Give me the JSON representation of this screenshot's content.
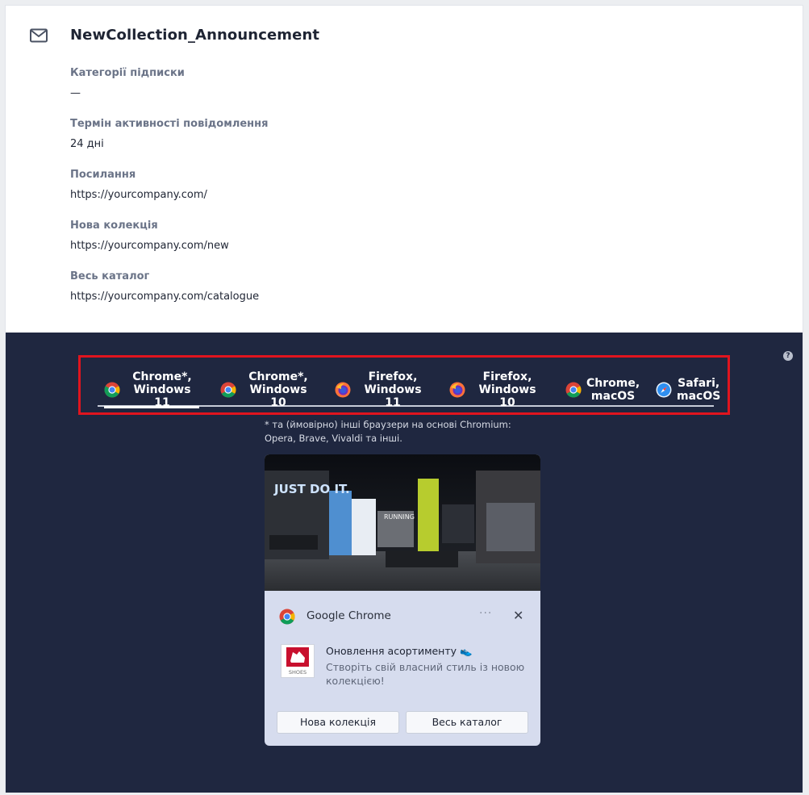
{
  "message": {
    "title": "NewCollection_Announcement",
    "icon": "envelope-icon"
  },
  "fields": [
    {
      "label": "Категорії підписки",
      "value": "—"
    },
    {
      "label": "Термін активності повідомлення",
      "value": "24 дні"
    },
    {
      "label": "Посилання",
      "value": "https://yourcompany.com/"
    },
    {
      "label": "Нова колекція",
      "value": "https://yourcompany.com/new"
    },
    {
      "label": "Весь каталог",
      "value": "https://yourcompany.com/catalogue"
    }
  ],
  "preview": {
    "help_glyph": "?",
    "tabs": [
      {
        "label": "Chrome*,\nWindows 11",
        "icon": "chrome-icon",
        "active": true
      },
      {
        "label": "Chrome*,\nWindows 10",
        "icon": "chrome-icon",
        "active": false
      },
      {
        "label": "Firefox,\nWindows 11",
        "icon": "firefox-icon",
        "active": false
      },
      {
        "label": "Firefox,\nWindows 10",
        "icon": "firefox-icon",
        "active": false
      },
      {
        "label": "Chrome,\nmacOS",
        "icon": "chrome-icon",
        "active": false
      },
      {
        "label": "Safari,\nmacOS",
        "icon": "safari-icon",
        "active": false
      }
    ],
    "footnote": "* та (ймовірно) інші браузери на основі Chromium: Opera, Brave, Vivaldi та інші.",
    "notification": {
      "app_name": "Google Chrome",
      "more_glyph": "···",
      "close_glyph": "✕",
      "thumb_text": "SHOES",
      "title": "Оновлення асортименту 👟",
      "body": "Створіть свій власний стиль із новою колекцією!",
      "buttons": [
        "Нова колекція",
        "Весь каталог"
      ],
      "hero_text_left": "JUST DO IT.",
      "hero_text_mid": "RUNNING"
    }
  },
  "colors": {
    "preview_bg": "#1f2740",
    "highlight": "#e0141e",
    "notification_bg": "#d6dcee"
  }
}
